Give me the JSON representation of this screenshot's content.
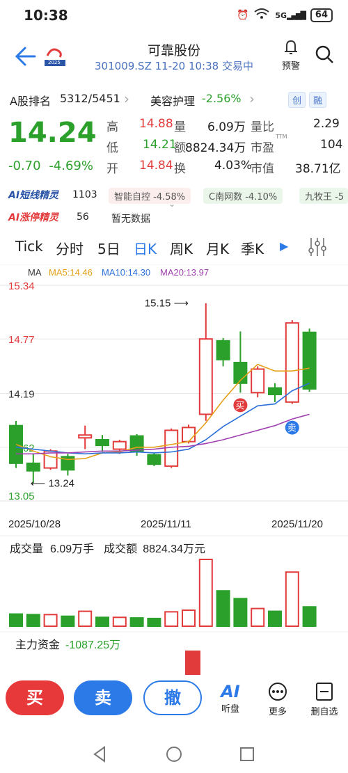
{
  "status": {
    "time": "10:38",
    "battery": "64",
    "signal": "5G"
  },
  "header": {
    "name": "可靠股份",
    "subtitle": "301009.SZ 11-20 10:38 交易中",
    "alert_label": "预警",
    "logo_text": "2025"
  },
  "rank": {
    "label": "A股排名",
    "value": "5312/5451",
    "sector": "美容护理",
    "sector_change": "-2.56%",
    "tag1": "创",
    "tag2": "融"
  },
  "quote": {
    "price": "14.24",
    "change": "-0.70",
    "change_pct": "-4.69%",
    "high_label": "高",
    "high": "14.88",
    "low_label": "低",
    "low": "14.21",
    "open_label": "开",
    "open": "14.84",
    "vol_label": "量",
    "vol": "6.09万",
    "amt_label": "额",
    "amt": "8824.34万",
    "turn_label": "换",
    "turn": "4.03%",
    "vr_label": "量比",
    "vr": "2.29",
    "pe_label": "市盈",
    "pe_sup": "TTM",
    "pe": "104",
    "mc_label": "市值",
    "mc": "38.71亿"
  },
  "ai": {
    "short_label": "AI短线精灵",
    "short_val": "1103",
    "chip1": "智能自控 -4.58%",
    "chip2": "C南网数 -4.10%",
    "chip3": "九牧王 -5",
    "limit_label": "AI涨停精灵",
    "limit_val": "56",
    "limit_text": "暂无数据"
  },
  "tabs": [
    "Tick",
    "分时",
    "5日",
    "日K",
    "周K",
    "月K",
    "季K"
  ],
  "active_tab": "日K",
  "chart_data": {
    "type": "candlestick",
    "ma_label": "MA",
    "ma5": "MA5:14.46",
    "ma10": "MA10:14.30",
    "ma20": "MA20:13.97",
    "ylabels": [
      "15.34",
      "14.77",
      "14.19",
      "13.62",
      "13.05"
    ],
    "ylim": [
      13.05,
      15.34
    ],
    "xlabels": [
      "2025/10/28",
      "2025/11/11",
      "2025/11/20"
    ],
    "high_marker": "15.15",
    "low_marker": "13.24",
    "buy_label": "买",
    "sell_label": "卖",
    "candles": [
      {
        "o": 13.85,
        "c": 13.45,
        "h": 13.9,
        "l": 13.4
      },
      {
        "o": 13.45,
        "c": 13.37,
        "h": 13.55,
        "l": 13.24
      },
      {
        "o": 13.4,
        "c": 13.58,
        "h": 13.6,
        "l": 13.38
      },
      {
        "o": 13.52,
        "c": 13.38,
        "h": 13.55,
        "l": 13.32
      },
      {
        "o": 13.72,
        "c": 13.75,
        "h": 13.85,
        "l": 13.6
      },
      {
        "o": 13.7,
        "c": 13.64,
        "h": 13.75,
        "l": 13.57
      },
      {
        "o": 13.6,
        "c": 13.68,
        "h": 13.7,
        "l": 13.55
      },
      {
        "o": 13.74,
        "c": 13.58,
        "h": 13.76,
        "l": 13.53
      },
      {
        "o": 13.54,
        "c": 13.44,
        "h": 13.56,
        "l": 13.42
      },
      {
        "o": 13.42,
        "c": 13.8,
        "h": 13.82,
        "l": 13.4
      },
      {
        "o": 13.68,
        "c": 13.83,
        "h": 13.86,
        "l": 13.66
      },
      {
        "o": 13.97,
        "c": 14.77,
        "h": 15.15,
        "l": 13.9
      },
      {
        "o": 14.75,
        "c": 14.55,
        "h": 14.78,
        "l": 14.48
      },
      {
        "o": 14.52,
        "c": 14.3,
        "h": 14.85,
        "l": 14.2
      },
      {
        "o": 14.2,
        "c": 14.45,
        "h": 14.48,
        "l": 14.15
      },
      {
        "o": 14.25,
        "c": 14.18,
        "h": 14.3,
        "l": 14.1
      },
      {
        "o": 14.1,
        "c": 14.94,
        "h": 14.97,
        "l": 14.08
      },
      {
        "o": 14.84,
        "c": 14.24,
        "h": 14.88,
        "l": 14.21
      }
    ],
    "ma5_values": [
      13.65,
      13.58,
      13.52,
      13.49,
      13.5,
      13.56,
      13.57,
      13.62,
      13.62,
      13.65,
      13.68,
      13.88,
      14.12,
      14.33,
      14.5,
      14.43,
      14.43,
      14.46
    ],
    "ma10_values": [
      13.62,
      13.6,
      13.58,
      13.56,
      13.55,
      13.56,
      13.56,
      13.57,
      13.56,
      13.57,
      13.6,
      13.7,
      13.84,
      13.95,
      14.06,
      14.08,
      14.22,
      14.3
    ],
    "ma20_values": [
      13.55,
      13.55,
      13.56,
      13.56,
      13.57,
      13.58,
      13.58,
      13.59,
      13.6,
      13.62,
      13.63,
      13.66,
      13.7,
      13.75,
      13.8,
      13.85,
      13.92,
      13.97
    ],
    "volume_label": "成交量",
    "volume_val": "6.09万手",
    "amount_label": "成交额",
    "amount_val": "8824.34万元",
    "volumes": [
      2.2,
      2.1,
      2.1,
      1.8,
      2.7,
      1.6,
      1.6,
      1.5,
      1.4,
      2.6,
      2.9,
      12.1,
      6.4,
      5.0,
      3.2,
      2.7,
      9.8,
      3.5
    ],
    "capital_label": "主力资金",
    "capital_val": "-1087.25万"
  },
  "bottom": {
    "buy": "买",
    "sell": "卖",
    "cancel": "撤",
    "listen_label": "听盘",
    "more_label": "更多",
    "delete_label": "删自选"
  },
  "colors": {
    "up": "#e23b3b",
    "down": "#2ba02b",
    "accent": "#2b7ae8"
  }
}
